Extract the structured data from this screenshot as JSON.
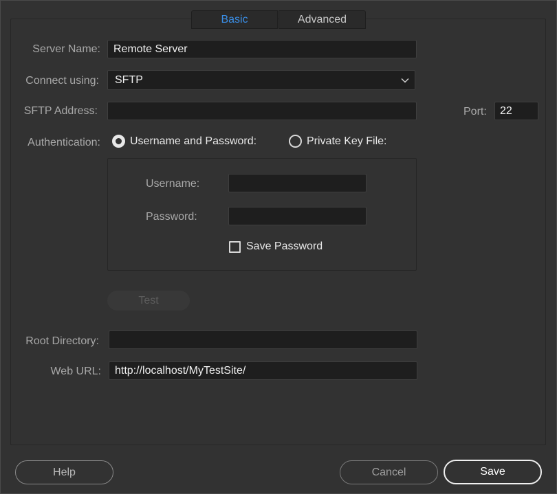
{
  "tabs": {
    "basic": "Basic",
    "advanced": "Advanced",
    "active": "basic",
    "active_color": "#3a8ee6"
  },
  "form": {
    "server_name": {
      "label": "Server Name:",
      "value": "Remote Server"
    },
    "connect_using": {
      "label": "Connect using:",
      "value": "SFTP",
      "icon": "chevron-down-icon"
    },
    "address": {
      "label": "SFTP Address:",
      "value": ""
    },
    "port": {
      "label": "Port:",
      "value": "22"
    },
    "authentication": {
      "label": "Authentication:",
      "options": [
        "Username and Password:",
        "Private Key File:"
      ],
      "selected": "Username and Password:"
    },
    "username": {
      "label": "Username:",
      "value": ""
    },
    "password": {
      "label": "Password:",
      "value": ""
    },
    "save_password": {
      "label": "Save Password",
      "checked": false
    },
    "test_label": "Test",
    "root_directory": {
      "label": "Root Directory:",
      "value": ""
    },
    "web_url": {
      "label": "Web URL:",
      "value": "http://localhost/MyTestSite/"
    }
  },
  "footer": {
    "help": "Help",
    "cancel": "Cancel",
    "save": "Save"
  }
}
